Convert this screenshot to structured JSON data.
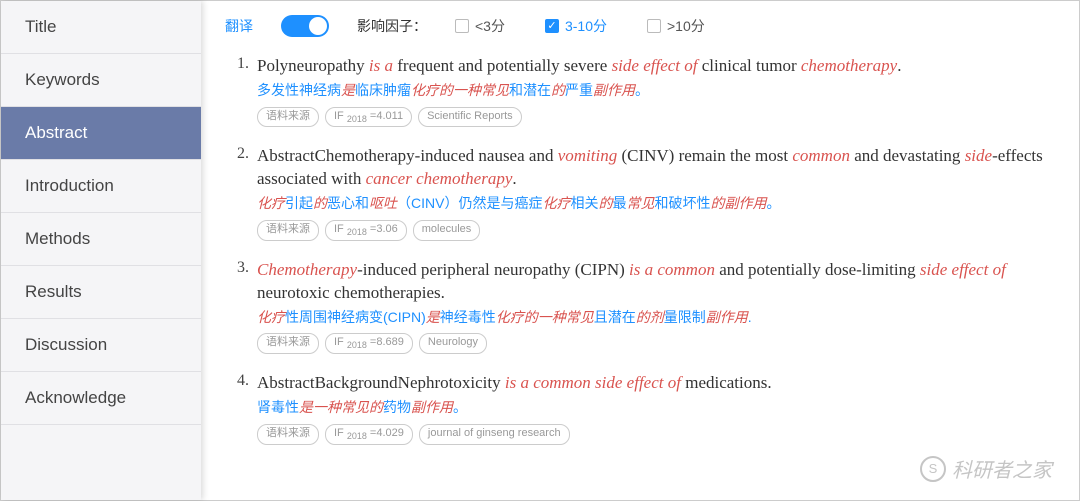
{
  "sidebar": {
    "items": [
      {
        "label": "Title"
      },
      {
        "label": "Keywords"
      },
      {
        "label": "Abstract"
      },
      {
        "label": "Introduction"
      },
      {
        "label": "Methods"
      },
      {
        "label": "Results"
      },
      {
        "label": "Discussion"
      },
      {
        "label": "Acknowledge"
      }
    ],
    "active_index": 2
  },
  "filters": {
    "translate_label": "翻译",
    "factor_label": "影响因子：",
    "options": [
      {
        "label": "<3分",
        "checked": false
      },
      {
        "label": "3-10分",
        "checked": true
      },
      {
        "label": ">10分",
        "checked": false
      }
    ]
  },
  "results": [
    {
      "num": "1.",
      "en_parts": [
        {
          "t": "Polyneuropathy "
        },
        {
          "t": "is a",
          "cls": "hl-red-i"
        },
        {
          "t": " frequent and potentially severe "
        },
        {
          "t": "side effect of",
          "cls": "hl-red-i"
        },
        {
          "t": " clinical tumor "
        },
        {
          "t": "chemotherapy",
          "cls": "hl-red-i"
        },
        {
          "t": "."
        }
      ],
      "zh_parts": [
        {
          "t": "多发性神经病"
        },
        {
          "t": "是",
          "cls": "hl-red-i"
        },
        {
          "t": "临床肿瘤"
        },
        {
          "t": "化疗的一种常见",
          "cls": "hl-red-i"
        },
        {
          "t": "和潜在"
        },
        {
          "t": "的",
          "cls": "hl-red-i"
        },
        {
          "t": "严重"
        },
        {
          "t": "副作用",
          "cls": "hl-red-i"
        },
        {
          "t": "。"
        }
      ],
      "tags": [
        "语料来源",
        "IF 2018 =4.011",
        "Scientific Reports"
      ]
    },
    {
      "num": "2.",
      "en_parts": [
        {
          "t": "AbstractChemotherapy-induced nausea and "
        },
        {
          "t": "vomiting",
          "cls": "hl-red-i"
        },
        {
          "t": " (CINV) remain the most "
        },
        {
          "t": "common",
          "cls": "hl-red-i"
        },
        {
          "t": " and devastating "
        },
        {
          "t": "side",
          "cls": "hl-red-i"
        },
        {
          "t": "-effects associated with "
        },
        {
          "t": "cancer chemotherapy",
          "cls": "hl-red-i"
        },
        {
          "t": "."
        }
      ],
      "zh_parts": [
        {
          "t": "化疗",
          "cls": "hl-red-i"
        },
        {
          "t": "引起"
        },
        {
          "t": "的",
          "cls": "hl-red-i"
        },
        {
          "t": "恶心和"
        },
        {
          "t": "呕吐",
          "cls": "hl-red-i"
        },
        {
          "t": "（CINV）仍然是与癌症"
        },
        {
          "t": "化疗",
          "cls": "hl-red-i"
        },
        {
          "t": "相关"
        },
        {
          "t": "的",
          "cls": "hl-red-i"
        },
        {
          "t": "最"
        },
        {
          "t": "常见",
          "cls": "hl-red-i"
        },
        {
          "t": "和破坏性"
        },
        {
          "t": "的副作用",
          "cls": "hl-red-i"
        },
        {
          "t": "。"
        }
      ],
      "tags": [
        "语料来源",
        "IF 2018 =3.06",
        "molecules"
      ]
    },
    {
      "num": "3.",
      "en_parts": [
        {
          "t": "Chemotherapy",
          "cls": "hl-red-i"
        },
        {
          "t": "-induced peripheral neuropathy (CIPN) "
        },
        {
          "t": "is a common",
          "cls": "hl-red-i"
        },
        {
          "t": " and potentially dose-limiting "
        },
        {
          "t": "side effect of",
          "cls": "hl-red-i"
        },
        {
          "t": " neurotoxic chemotherapies."
        }
      ],
      "zh_parts": [
        {
          "t": "化疗",
          "cls": "hl-red-i"
        },
        {
          "t": "性周围神经病变(CIPN)"
        },
        {
          "t": "是",
          "cls": "hl-red-i"
        },
        {
          "t": "神经毒性"
        },
        {
          "t": "化疗的一种常见",
          "cls": "hl-red-i"
        },
        {
          "t": "且潜在"
        },
        {
          "t": "的剂",
          "cls": "hl-red-i"
        },
        {
          "t": "量限制"
        },
        {
          "t": "副作用",
          "cls": "hl-red-i"
        },
        {
          "t": "."
        }
      ],
      "tags": [
        "语料来源",
        "IF 2018 =8.689",
        "Neurology"
      ]
    },
    {
      "num": "4.",
      "en_parts": [
        {
          "t": "AbstractBackgroundNephrotoxicity "
        },
        {
          "t": "is a common side effect of",
          "cls": "hl-red-i"
        },
        {
          "t": " medications."
        }
      ],
      "zh_parts": [
        {
          "t": "肾毒性"
        },
        {
          "t": "是一种常见的",
          "cls": "hl-red-i"
        },
        {
          "t": "药物"
        },
        {
          "t": "副作用",
          "cls": "hl-red-i"
        },
        {
          "t": "。"
        }
      ],
      "tags": [
        "语料来源",
        "IF 2018 =4.029",
        "journal of ginseng research"
      ]
    }
  ],
  "watermark": {
    "icon": "S",
    "text": "科研者之家"
  }
}
